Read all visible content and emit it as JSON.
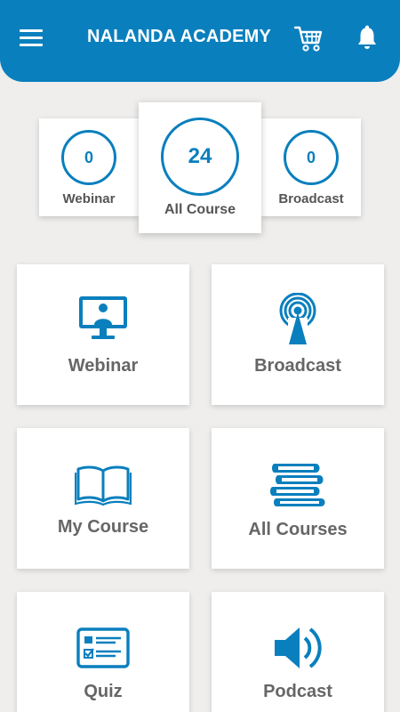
{
  "header": {
    "title": "NALANDA ACADEMY",
    "menu_icon": "hamburger-menu-icon",
    "cart_icon": "shopping-cart-icon",
    "bell_icon": "notification-bell-icon"
  },
  "stats": {
    "webinar": {
      "count": "0",
      "label": "Webinar"
    },
    "all_course": {
      "count": "24",
      "label": "All Course"
    },
    "broadcast": {
      "count": "0",
      "label": "Broadcast"
    }
  },
  "tiles": {
    "webinar": {
      "label": "Webinar",
      "icon": "monitor-presenter-icon"
    },
    "broadcast": {
      "label": "Broadcast",
      "icon": "broadcast-antenna-icon"
    },
    "my_course": {
      "label": "My Course",
      "icon": "open-book-icon"
    },
    "all_courses": {
      "label": "All Courses",
      "icon": "stacked-books-icon"
    },
    "quiz": {
      "label": "Quiz",
      "icon": "quiz-checklist-icon"
    },
    "podcast": {
      "label": "Podcast",
      "icon": "speaker-icon"
    }
  },
  "colors": {
    "primary": "#0a7fbd",
    "background": "#efeeed",
    "label_gray": "#666666"
  }
}
